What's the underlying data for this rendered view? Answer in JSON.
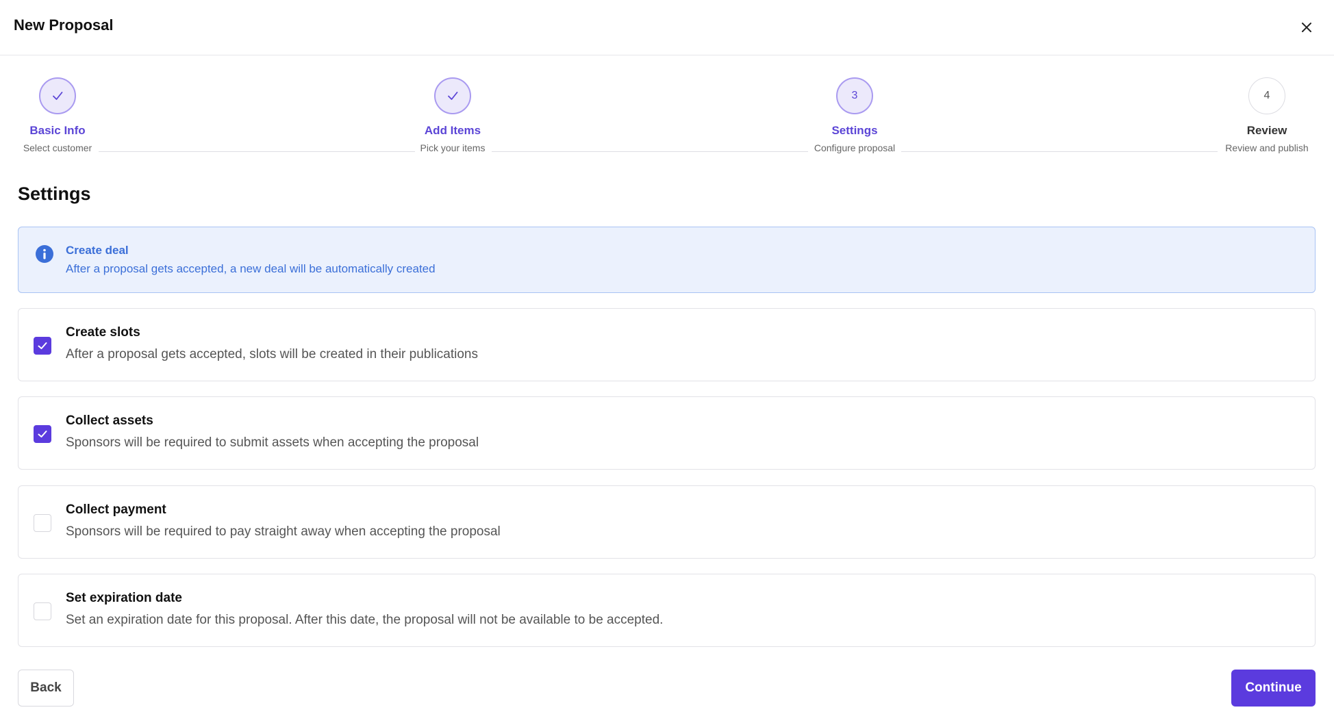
{
  "header": {
    "title": "New Proposal",
    "close_icon": "close-icon"
  },
  "stepper": {
    "steps": [
      {
        "label": "Basic Info",
        "sublabel": "Select customer",
        "state": "done",
        "icon": "check-icon"
      },
      {
        "label": "Add Items",
        "sublabel": "Pick your items",
        "state": "done",
        "icon": "check-icon"
      },
      {
        "label": "Settings",
        "sublabel": "Configure proposal",
        "state": "active",
        "number": "3"
      },
      {
        "label": "Review",
        "sublabel": "Review and publish",
        "state": "pending",
        "number": "4"
      }
    ]
  },
  "main": {
    "title": "Settings",
    "info": {
      "icon": "info-icon",
      "title": "Create deal",
      "description": "After a proposal gets accepted, a new deal will be automatically created"
    },
    "options": [
      {
        "title": "Create slots",
        "description": "After a proposal gets accepted, slots will be created in their publications",
        "checked": true
      },
      {
        "title": "Collect assets",
        "description": "Sponsors will be required to submit assets when accepting the proposal",
        "checked": true
      },
      {
        "title": "Collect payment",
        "description": "Sponsors will be required to pay straight away when accepting the proposal",
        "checked": false
      },
      {
        "title": "Set expiration date",
        "description": "Set an expiration date for this proposal. After this date, the proposal will not be available to be accepted.",
        "checked": false
      }
    ]
  },
  "footer": {
    "back_label": "Back",
    "continue_label": "Continue"
  },
  "colors": {
    "accent": "#5b3bde",
    "step_purple": "#5b45d6",
    "info_blue": "#3b6fd8",
    "info_bg": "#ebf1fd"
  }
}
